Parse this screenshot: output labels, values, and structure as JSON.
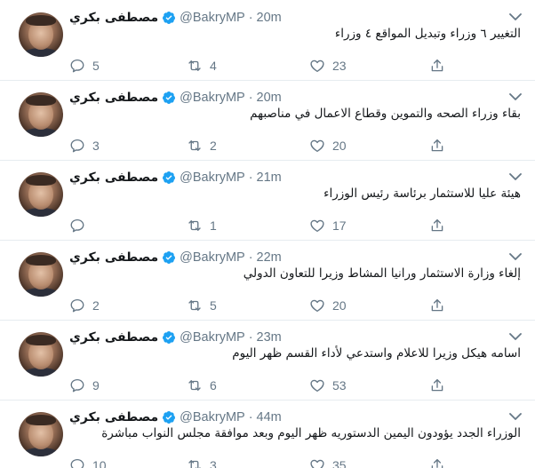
{
  "colors": {
    "icon": "#657786",
    "verified": "#1da1f2",
    "divider": "#e6ecf0"
  },
  "tweets": [
    {
      "name": "مصطفى بكري",
      "handle": "@BakryMP",
      "sep": "·",
      "time": "20m",
      "text": "التغيير ٦ وزراء وتبديل المواقع ٤ وزراء",
      "replies": "5",
      "retweets": "4",
      "likes": "23"
    },
    {
      "name": "مصطفى بكري",
      "handle": "@BakryMP",
      "sep": "·",
      "time": "20m",
      "text": "بقاء  وزراء الصحه والتموين وقطاع الاعمال في مناصبهم",
      "replies": "3",
      "retweets": "2",
      "likes": "20"
    },
    {
      "name": "مصطفى بكري",
      "handle": "@BakryMP",
      "sep": "·",
      "time": "21m",
      "text": "هيئة عليا للاستثمار برئاسة رئيس الوزراء",
      "replies": "",
      "retweets": "1",
      "likes": "17"
    },
    {
      "name": "مصطفى بكري",
      "handle": "@BakryMP",
      "sep": "·",
      "time": "22m",
      "text": "إلغاء وزارة الاستثمار ورانيا المشاط وزيرا للتعاون الدولي",
      "replies": "2",
      "retweets": "5",
      "likes": "20"
    },
    {
      "name": "مصطفى بكري",
      "handle": "@BakryMP",
      "sep": "·",
      "time": "23m",
      "text": "اسامه هيكل وزيرا للاعلام واستدعي لأداء القسم ظهر اليوم",
      "replies": "9",
      "retweets": "6",
      "likes": "53"
    },
    {
      "name": "مصطفى بكري",
      "handle": "@BakryMP",
      "sep": "·",
      "time": "44m",
      "text": "الوزراء الجدد يؤودون اليمين الدستوريه ظهر اليوم وبعد موافقة مجلس النواب مباشرة",
      "replies": "10",
      "retweets": "3",
      "likes": "35"
    }
  ],
  "icons": {
    "reply": "reply-icon",
    "retweet": "retweet-icon",
    "like": "heart-icon",
    "share": "share-icon",
    "verified": "verified-badge-icon",
    "caret": "chevron-down-icon"
  }
}
